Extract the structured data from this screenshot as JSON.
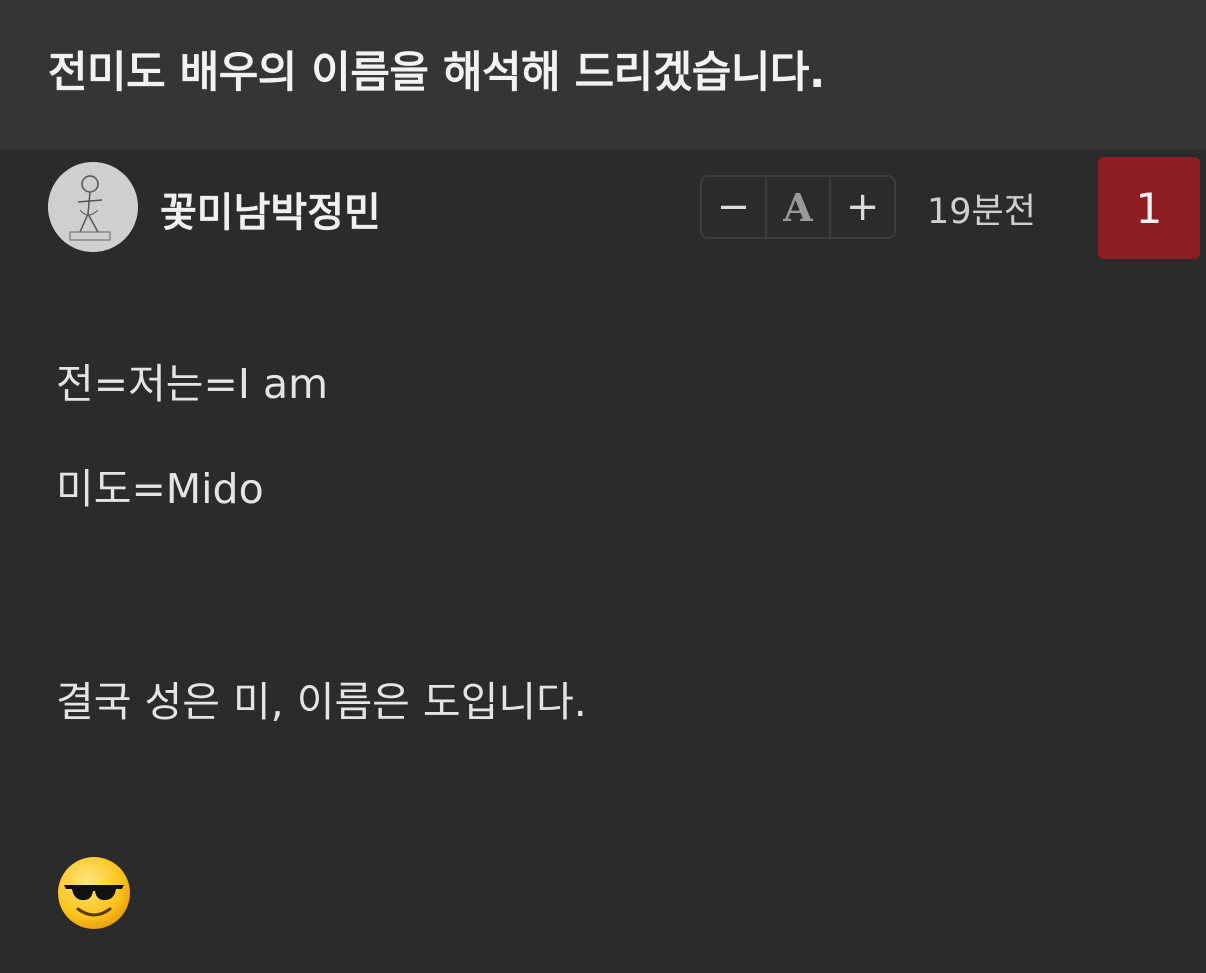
{
  "post": {
    "title": "전미도 배우의 이름을 해석해 드리겠습니다."
  },
  "author": {
    "name": "꽃미남박정민",
    "avatar_icon": "avatar-sketch-icon"
  },
  "font_controls": {
    "decrease_label": "−",
    "font_label": "A",
    "increase_label": "+"
  },
  "meta": {
    "timestamp": "19분전",
    "count": "1"
  },
  "content": {
    "lines": [
      "전=저는=I am",
      "미도=Mido",
      "결국 성은 미, 이름은 도입니다."
    ],
    "emoji": "smiling-face-with-sunglasses-icon"
  },
  "colors": {
    "background": "#2b2b2c",
    "header_background": "#353536",
    "badge": "#8e1d24"
  }
}
